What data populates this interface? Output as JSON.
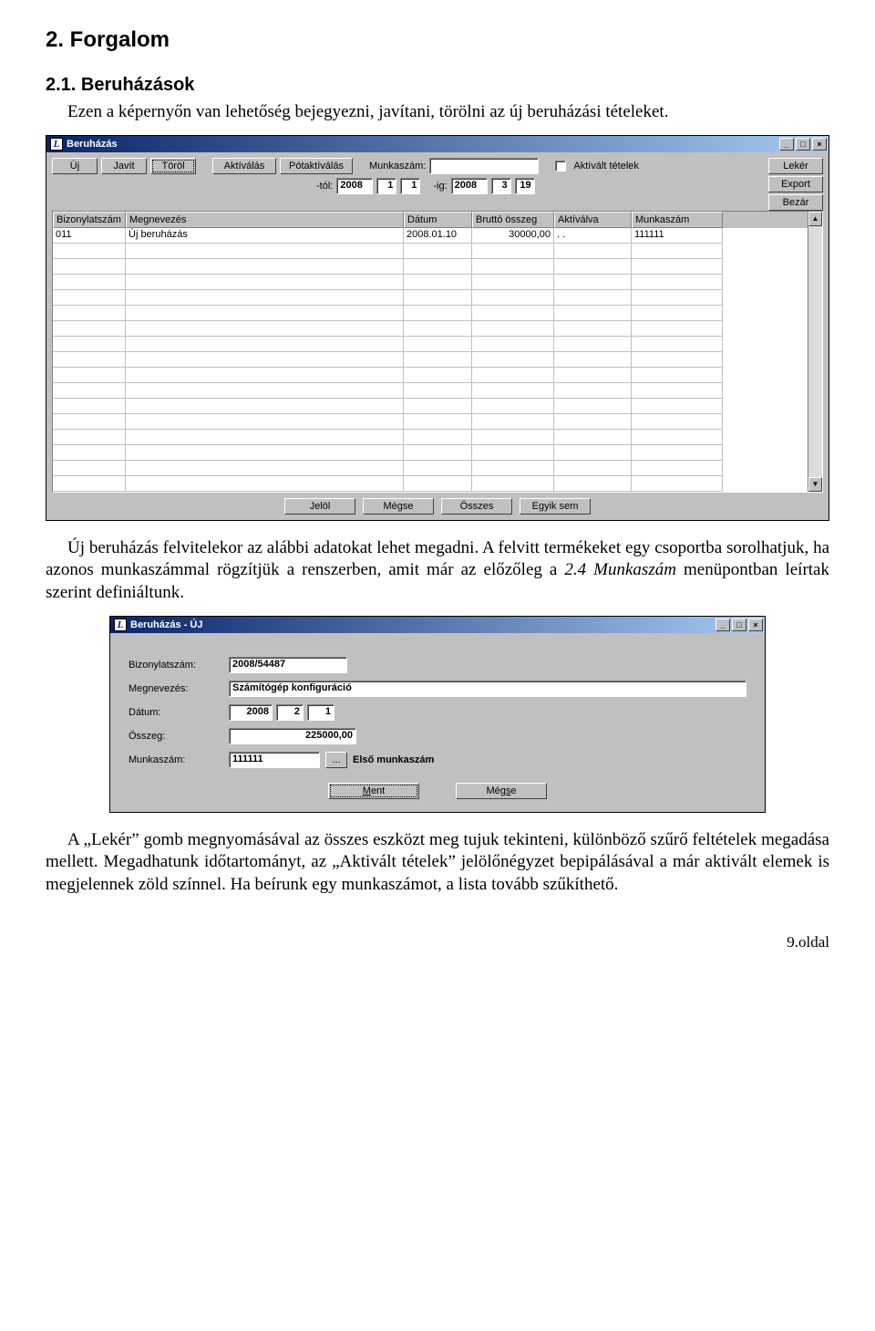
{
  "doc": {
    "h2": "2. Forgalom",
    "h3": "2.1. Beruházások",
    "p1": "Ezen a képernyőn van lehetőség bejegyezni, javítani, törölni az új beruházási tételeket.",
    "p2a": "Új beruházás felvitelekor az alábbi adatokat lehet megadni. A felvitt termékeket egy csoportba sorolhatjuk, ha azonos munkaszámmal rögzítjük a renszerben, amit már az előzőleg a ",
    "p2_em": "2.4 Munkaszám",
    "p2b": " menüpontban leírtak szerint definiáltunk.",
    "p3": "A „Lekér” gomb megnyomásával az összes eszközt meg tujuk tekinteni, különböző szűrő feltételek megadása mellett. Megadhatunk időtartományt, az „Aktivált tételek” jelölőnégyzet bepipálásával a már aktivált elemek is megjelennek zöld színnel. Ha beírunk egy munkaszámot, a lista tovább szűkíthető.",
    "page": "9.oldal"
  },
  "win1": {
    "title": "Beruházás",
    "buttons": {
      "uj": "Új",
      "javit": "Javít",
      "torol": "Töröl",
      "aktivalas": "Aktíválás",
      "potaktivalas": "Pótaktíválás",
      "leker": "Lekér",
      "export": "Export",
      "bezar": "Bezár"
    },
    "labels": {
      "munkaszam": "Munkaszám:",
      "aktivalt": "Aktívált tételek",
      "tol": "-tól:",
      "ig": "-ig:"
    },
    "date_from": {
      "y": "2008",
      "m": "1",
      "d": "1"
    },
    "date_to": {
      "y": "2008",
      "m": "3",
      "d": "19"
    },
    "headers": {
      "biz": "Bizonylatszám",
      "meg": "Megnevezés",
      "dat": "Dátum",
      "bru": "Bruttó összeg",
      "akt": "Aktíválva",
      "mun": "Munkaszám"
    },
    "row1": {
      "biz": "011",
      "meg": "Új beruházás",
      "dat": "2008.01.10",
      "bru": "30000,00",
      "akt": ". .",
      "mun": "111111"
    },
    "bottom": {
      "jelol": "Jelöl",
      "megse": "Mégse",
      "osszes": "Összes",
      "egyik": "Egyik sem"
    }
  },
  "win2": {
    "title": "Beruházás - ÚJ",
    "labels": {
      "biz": "Bizonylatszám:",
      "meg": "Megnevezés:",
      "dat": "Dátum:",
      "oss": "Összeg:",
      "mun": "Munkaszám:"
    },
    "values": {
      "biz": "2008/54487",
      "meg": "Számítógép konfiguráció",
      "dat_y": "2008",
      "dat_m": "2",
      "dat_d": "1",
      "oss": "225000,00",
      "mun_code": "111111",
      "mun_name": "Első munkaszám",
      "browse": "..."
    },
    "buttons": {
      "ment_pre": "M",
      "ment_post": "ent",
      "megse_pre": "Még",
      "megse_post": "e",
      "megse_u": "s"
    }
  }
}
